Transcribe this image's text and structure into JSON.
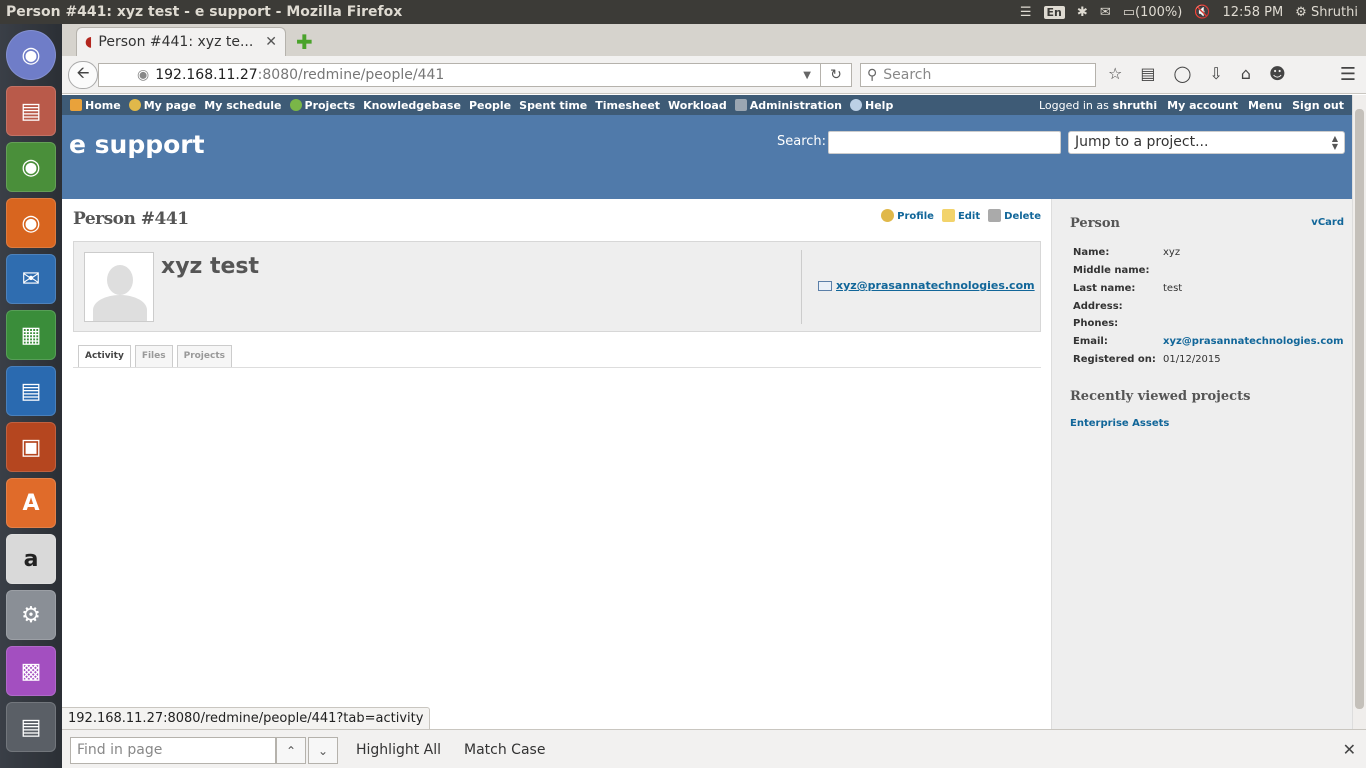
{
  "window": {
    "title": "Person #441: xyz test - e support - Mozilla Firefox"
  },
  "tray": {
    "keyboard": "En",
    "battery": "(100%)",
    "time": "12:58 PM",
    "user": "Shruthi"
  },
  "browser": {
    "tab_title": "Person #441: xyz te...",
    "url_host": "192.168.11.27",
    "url_path": ":8080/redmine/people/441",
    "search_placeholder": "Search",
    "status_url": "192.168.11.27:8080/redmine/people/441?tab=activity"
  },
  "topmenu": {
    "items": [
      "Home",
      "My page",
      "My schedule",
      "Projects",
      "Knowledgebase",
      "People",
      "Spent time",
      "Timesheet",
      "Workload",
      "Administration",
      "Help"
    ],
    "logged_prefix": "Logged in as",
    "logged_user": "shruthi",
    "my_account": "My account",
    "menu": "Menu",
    "sign_out": "Sign out"
  },
  "header": {
    "project": "e support",
    "search_label": "Search:",
    "jump": "Jump to a project..."
  },
  "content": {
    "title": "Person #441",
    "actions": {
      "profile": "Profile",
      "edit": "Edit",
      "delete": "Delete"
    },
    "person_name": "xyz test",
    "email": "xyz@prasannatechnologies.com",
    "tabs": [
      "Activity",
      "Files",
      "Projects"
    ]
  },
  "sidebar": {
    "heading": "Person",
    "vcard": "vCard",
    "attrs": [
      {
        "k": "Name:",
        "v": "xyz"
      },
      {
        "k": "Middle name:",
        "v": ""
      },
      {
        "k": "Last name:",
        "v": "test"
      },
      {
        "k": "Address:",
        "v": ""
      },
      {
        "k": "Phones:",
        "v": ""
      },
      {
        "k": "Email:",
        "v": "xyz@prasannatechnologies.com"
      },
      {
        "k": "Registered on:",
        "v": "01/12/2015"
      }
    ],
    "recent_heading": "Recently viewed projects",
    "recent_project": "Enterprise Assets"
  },
  "findbar": {
    "placeholder": "Find in page",
    "highlight": "Highlight All",
    "match_case": "Match Case"
  }
}
